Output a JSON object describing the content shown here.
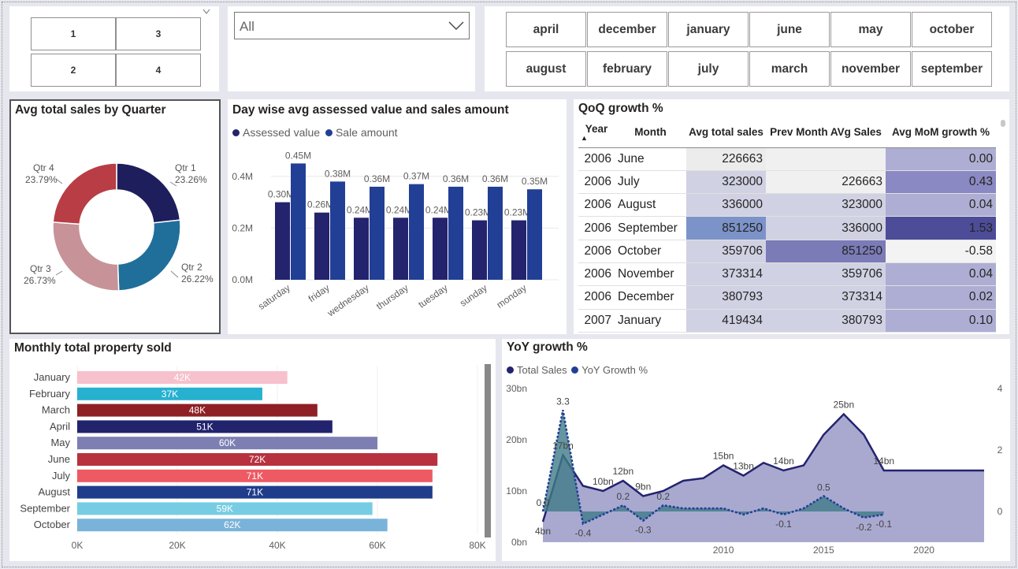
{
  "slicers": {
    "quarter_tiles": [
      "1",
      "3",
      "2",
      "4"
    ],
    "dropdown_value": "All",
    "months": [
      "april",
      "december",
      "january",
      "june",
      "may",
      "october",
      "august",
      "february",
      "july",
      "march",
      "november",
      "september"
    ]
  },
  "quarter_card": {
    "title": "Avg total sales by Quarter",
    "labels": [
      {
        "name": "Qtr 1",
        "pct": "23.26%"
      },
      {
        "name": "Qtr 2",
        "pct": "26.22%"
      },
      {
        "name": "Qtr 3",
        "pct": "26.73%"
      },
      {
        "name": "Qtr 4",
        "pct": "23.79%"
      }
    ]
  },
  "day_card": {
    "title": "Day wise avg assessed value and sales amount",
    "legend": [
      "Assessed value",
      "Sale amount"
    ]
  },
  "qoq_card": {
    "title": "QoQ growth %",
    "headers": [
      "Year",
      "Month",
      "Avg total sales",
      "Prev Month AVg Sales",
      "Avg MoM growth %"
    ],
    "rows": [
      [
        "2006",
        "June",
        "226663",
        "",
        "0.00"
      ],
      [
        "2006",
        "July",
        "323000",
        "226663",
        "0.43"
      ],
      [
        "2006",
        "August",
        "336000",
        "323000",
        "0.04"
      ],
      [
        "2006",
        "September",
        "851250",
        "336000",
        "1.53"
      ],
      [
        "2006",
        "October",
        "359706",
        "851250",
        "-0.58"
      ],
      [
        "2006",
        "November",
        "373314",
        "359706",
        "0.04"
      ],
      [
        "2006",
        "December",
        "380793",
        "373314",
        "0.02"
      ],
      [
        "2007",
        "January",
        "419434",
        "380793",
        "0.10"
      ]
    ]
  },
  "monthly_card": {
    "title": "Monthly total property sold"
  },
  "yoy_card": {
    "title": "YoY growth %",
    "legend": [
      "Total Sales",
      "YoY Growth %"
    ]
  },
  "colors": {
    "navy": "#23236e",
    "blue": "#223f96",
    "quarter": [
      "#1e1e5c",
      "#1f6f9a",
      "#c79398",
      "#b83d45"
    ],
    "yoy_area": "#9a9ac8",
    "yoy_growth_fill": "#3f7a86"
  },
  "chart_data": [
    {
      "type": "pie",
      "title": "Avg total sales by Quarter",
      "categories": [
        "Qtr 1",
        "Qtr 2",
        "Qtr 3",
        "Qtr 4"
      ],
      "values": [
        23.26,
        26.22,
        26.73,
        23.79
      ],
      "value_labels": [
        "23.26%",
        "26.22%",
        "26.73%",
        "23.79%"
      ],
      "donut": true
    },
    {
      "type": "bar",
      "title": "Day wise avg assessed value and sales amount",
      "categories": [
        "saturday",
        "friday",
        "wednesday",
        "thursday",
        "tuesday",
        "sunday",
        "monday"
      ],
      "series": [
        {
          "name": "Assessed value",
          "values": [
            0.3,
            0.26,
            0.24,
            0.24,
            0.24,
            0.23,
            0.23
          ],
          "labels": [
            "0.30M",
            "0.26M",
            "0.24M",
            "0.24M",
            "0.24M",
            "0.23M",
            "0.23M"
          ]
        },
        {
          "name": "Sale amount",
          "values": [
            0.45,
            0.38,
            0.36,
            0.37,
            0.36,
            0.36,
            0.35
          ],
          "labels": [
            "0.45M",
            "0.38M",
            "0.36M",
            "0.37M",
            "0.36M",
            "0.36M",
            "0.35M"
          ]
        }
      ],
      "ylim": [
        0,
        0.5
      ],
      "yticks": [
        "0.0M",
        "0.2M",
        "0.4M"
      ],
      "ytick_values": [
        0,
        0.2,
        0.4
      ]
    },
    {
      "type": "bar",
      "orientation": "horizontal",
      "title": "Monthly total property sold",
      "categories": [
        "January",
        "February",
        "March",
        "April",
        "May",
        "June",
        "July",
        "August",
        "September",
        "October"
      ],
      "values": [
        42,
        37,
        48,
        51,
        60,
        72,
        71,
        71,
        59,
        62
      ],
      "labels": [
        "42K",
        "37K",
        "48K",
        "51K",
        "60K",
        "72K",
        "71K",
        "71K",
        "59K",
        "62K"
      ],
      "bar_colors": [
        "#f6c1cc",
        "#27b1d0",
        "#8e2025",
        "#22236d",
        "#7d7fb3",
        "#b7313f",
        "#ee5a64",
        "#203d8c",
        "#76cde3",
        "#7ab3d9"
      ],
      "xlim": [
        0,
        80
      ],
      "xticks": [
        "0K",
        "20K",
        "40K",
        "60K",
        "80K"
      ],
      "xtick_values": [
        0,
        20,
        40,
        60,
        80
      ]
    },
    {
      "type": "area",
      "title": "YoY growth %",
      "series": [
        {
          "name": "Total Sales",
          "x": [
            2001,
            2002,
            2003,
            2004,
            2005,
            2006,
            2007,
            2008,
            2009,
            2010,
            2011,
            2012,
            2013,
            2014,
            2015,
            2016,
            2017,
            2018,
            2019,
            2020,
            2021,
            2022,
            2023
          ],
          "values": [
            4,
            17,
            11,
            10,
            12,
            9,
            10,
            12,
            12.5,
            15,
            13,
            15.5,
            14,
            15,
            21,
            25,
            21,
            14,
            14,
            14,
            14,
            14,
            14
          ],
          "point_labels": {
            "2001": "4bn",
            "2002": "17bn",
            "2004": "10bn",
            "2005": "12bn",
            "2006": "9bn",
            "2010": "15bn",
            "2011": "13bn",
            "2013": "14bn",
            "2016": "25bn",
            "2018": "14bn"
          }
        },
        {
          "name": "YoY Growth %",
          "x": [
            2001,
            2002,
            2003,
            2004,
            2005,
            2006,
            2007,
            2008,
            2009,
            2010,
            2011,
            2012,
            2013,
            2014,
            2015,
            2016,
            2017,
            2018
          ],
          "values": [
            0,
            3.3,
            -0.4,
            -0.1,
            0.2,
            -0.3,
            0.2,
            0.1,
            0.1,
            0.1,
            -0.1,
            0.1,
            -0.1,
            0.1,
            0.5,
            0.1,
            -0.2,
            -0.1
          ],
          "point_labels": {
            "2001": "0.0",
            "2002": "3.3",
            "2003": "-0.4",
            "2005": "0.2",
            "2006": "-0.3",
            "2007": "0.2",
            "2013": "-0.1",
            "2015": "0.5",
            "2017": "-0.2",
            "2018": "-0.1"
          }
        }
      ],
      "xticks": [
        "2010",
        "2015",
        "2020"
      ],
      "yticks_left": [
        "0bn",
        "10bn",
        "20bn",
        "30bn"
      ],
      "ylim_left": [
        0,
        30
      ],
      "yticks_right": [
        "0",
        "2",
        "4"
      ],
      "ylim_right": [
        -1,
        4
      ]
    }
  ]
}
